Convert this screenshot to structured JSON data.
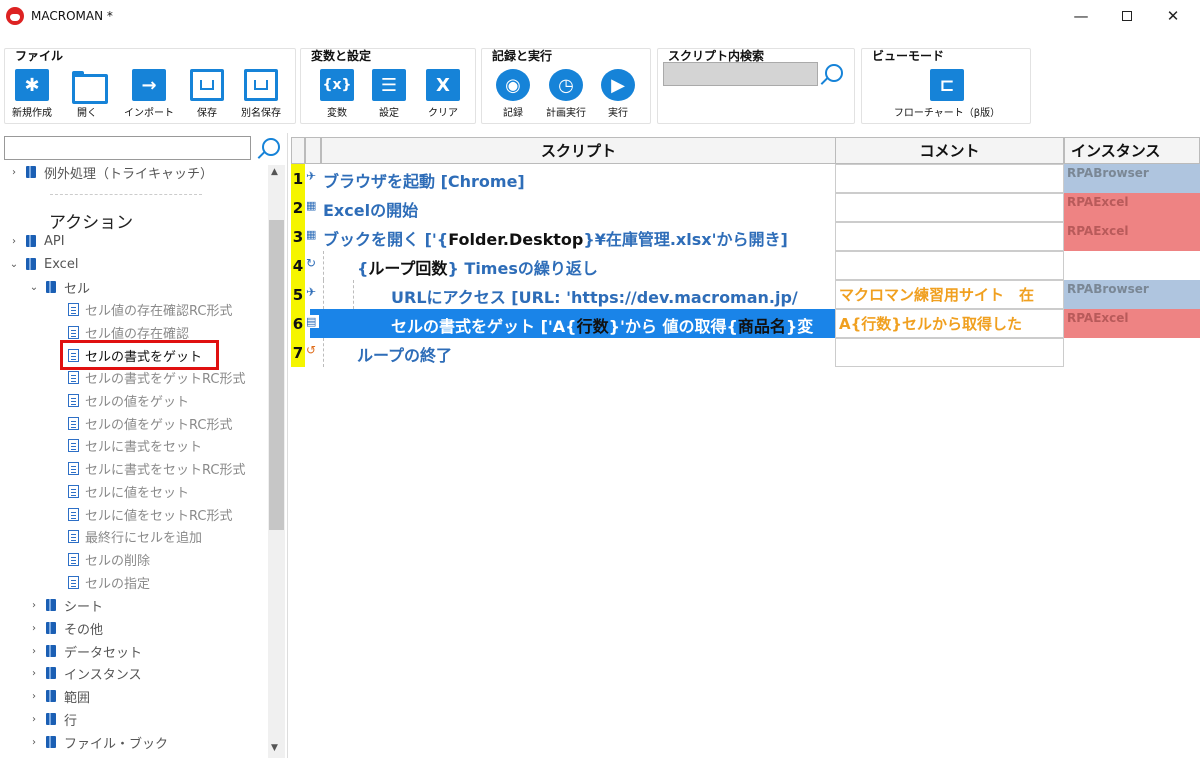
{
  "window": {
    "title": "MACROMAN *",
    "min": "—",
    "close": "✕"
  },
  "ribbon": {
    "file": {
      "title": "ファイル",
      "buttons": [
        "新規作成",
        "開く",
        "インポート",
        "保存",
        "別名保存"
      ]
    },
    "vars": {
      "title": "変数と設定",
      "buttons": [
        "変数",
        "設定",
        "クリア"
      ],
      "var_glyph": "{x}",
      "clear_glyph": "X"
    },
    "record": {
      "title": "記録と実行",
      "buttons": [
        "記録",
        "計画実行",
        "実行"
      ]
    },
    "search": {
      "title": "スクリプト内検索",
      "value": ""
    },
    "view": {
      "title": "ビューモード",
      "buttons": [
        "フローチャート（β版）"
      ]
    }
  },
  "tree": {
    "search_value": "",
    "top_item": "例外処理（トライキャッチ）",
    "section": "アクション",
    "items": {
      "api": "API",
      "excel": "Excel",
      "cell": "セル",
      "cell_children": [
        "セル値の存在確認RC形式",
        "セル値の存在確認",
        "セルの書式をゲット",
        "セルの書式をゲットRC形式",
        "セルの値をゲット",
        "セルの値をゲットRC形式",
        "セルに書式をセット",
        "セルに書式をセットRC形式",
        "セルに値をセット",
        "セルに値をセットRC形式",
        "最終行にセルを追加",
        "セルの削除",
        "セルの指定"
      ],
      "siblings": [
        "シート",
        "その他",
        "データセット",
        "インスタンス",
        "範囲",
        "行",
        "ファイル・ブック"
      ]
    }
  },
  "grid": {
    "headers": {
      "script": "スクリプト",
      "comment": "コメント",
      "instance": "インスタンス"
    },
    "rows": [
      {
        "num": "1",
        "script": "ブラウザを起動 [Chrome]",
        "comment": "",
        "instance": "RPABrowser"
      },
      {
        "num": "2",
        "script": "Excelの開始",
        "comment": "",
        "instance": "RPAExcel"
      },
      {
        "num": "3",
        "script_a": "ブックを開く ['{",
        "script_b": "Folder.Desktop",
        "script_c": "}¥在庫管理.xlsx'から開き]",
        "comment": "",
        "instance": "RPAExcel"
      },
      {
        "num": "4",
        "script_a": "{",
        "script_b": "ループ回数",
        "script_c": "} Timesの繰り返し",
        "comment": "",
        "instance": ""
      },
      {
        "num": "5",
        "script": "URLにアクセス [URL: 'https://dev.macroman.jp/",
        "comment": "マクロマン練習用サイト　在",
        "instance": "RPABrowser"
      },
      {
        "num": "6",
        "script_a": "セルの書式をゲット ['A{",
        "script_b": "行数",
        "script_c": "}'から 値の取得{",
        "script_d": "商品名",
        "script_e": "}変",
        "comment": "A{行数}セルから取得した",
        "instance": "RPAExcel"
      },
      {
        "num": "7",
        "script": "ループの終了",
        "comment": "",
        "instance": ""
      }
    ]
  }
}
